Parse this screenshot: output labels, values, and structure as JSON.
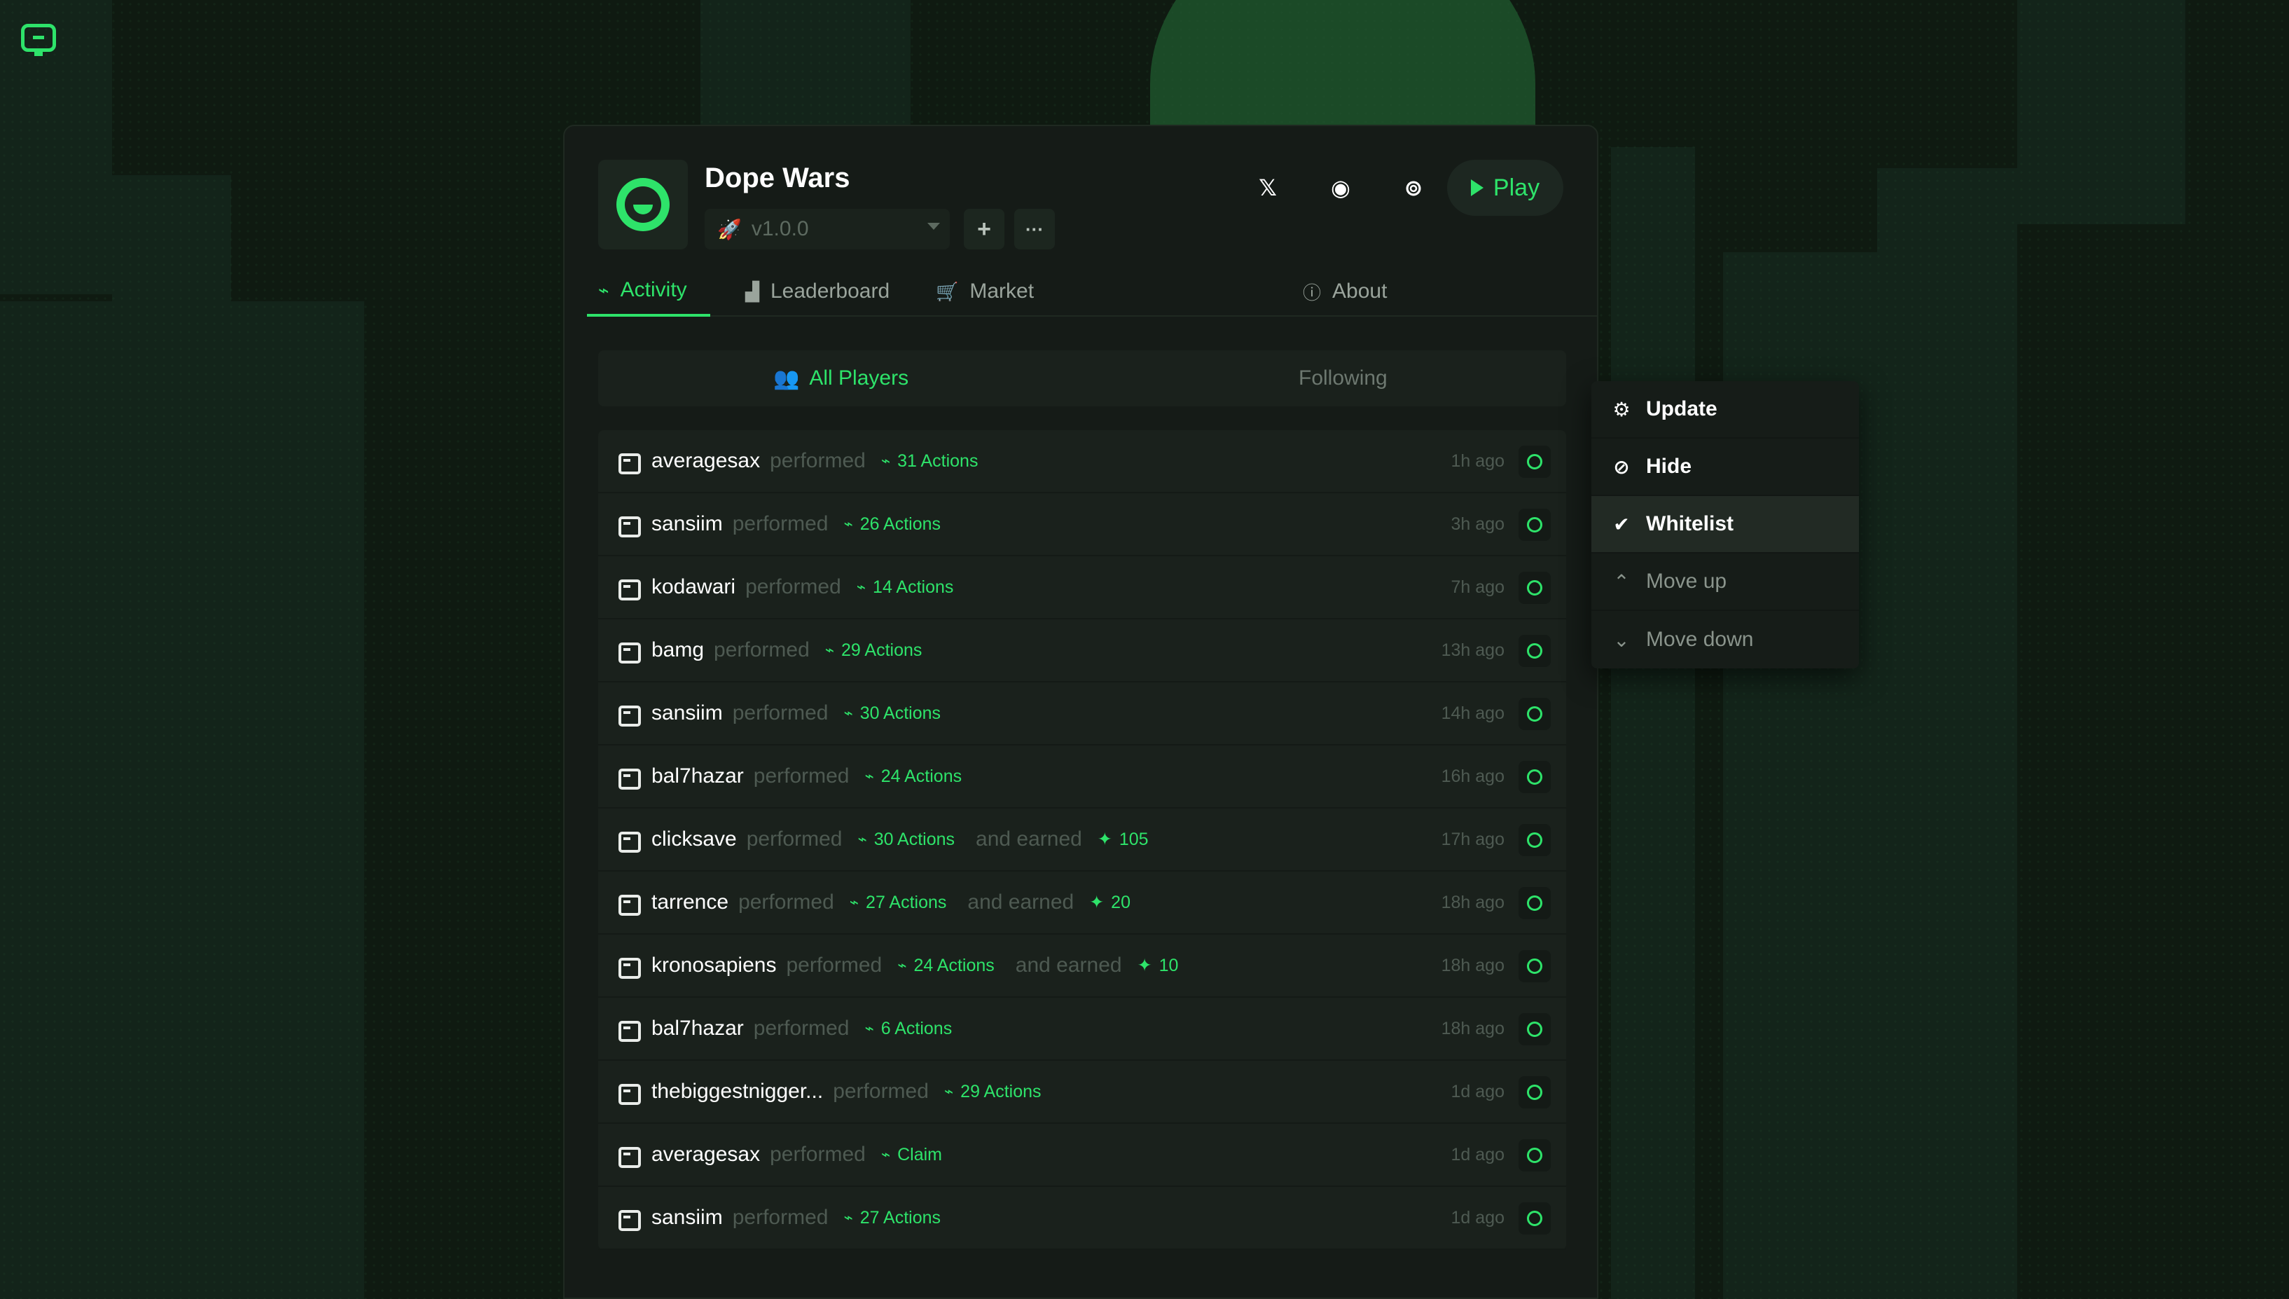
{
  "game": {
    "title": "Dope Wars",
    "version": "v1.0.0",
    "add_icon": "+",
    "more_icon": "···",
    "play_label": "Play"
  },
  "social": [
    {
      "name": "x-icon",
      "glyph": "𝕏"
    },
    {
      "name": "discord-icon",
      "glyph": "◉"
    },
    {
      "name": "github-icon",
      "glyph": "⊚"
    }
  ],
  "tabs": [
    {
      "label": "Activity",
      "icon": "activity-icon",
      "active": true
    },
    {
      "label": "Leaderboard",
      "icon": "leaderboard-icon"
    },
    {
      "label": "Market",
      "icon": "cart-icon"
    },
    {
      "label": "About",
      "icon": "info-icon"
    }
  ],
  "subtabs": {
    "all_players": "All Players",
    "following": "Following"
  },
  "menu": [
    {
      "label": "Update",
      "icon": "gear-icon",
      "state": "enabled"
    },
    {
      "label": "Hide",
      "icon": "eye-off-icon",
      "state": "enabled"
    },
    {
      "label": "Whitelist",
      "icon": "check-circle-icon",
      "state": "enabled",
      "highlight": true
    },
    {
      "label": "Move up",
      "icon": "chevron-up-icon",
      "state": "disabled"
    },
    {
      "label": "Move down",
      "icon": "chevron-down-icon",
      "state": "disabled"
    }
  ],
  "activity": [
    {
      "user": "averagesax",
      "verb": "performed",
      "actions": "31 Actions",
      "earned_label": "",
      "earned": "",
      "time": "1h ago"
    },
    {
      "user": "sansiim",
      "verb": "performed",
      "actions": "26 Actions",
      "earned_label": "",
      "earned": "",
      "time": "3h ago"
    },
    {
      "user": "kodawari",
      "verb": "performed",
      "actions": "14 Actions",
      "earned_label": "",
      "earned": "",
      "time": "7h ago"
    },
    {
      "user": "bamg",
      "verb": "performed",
      "actions": "29 Actions",
      "earned_label": "",
      "earned": "",
      "time": "13h ago"
    },
    {
      "user": "sansiim",
      "verb": "performed",
      "actions": "30 Actions",
      "earned_label": "",
      "earned": "",
      "time": "14h ago"
    },
    {
      "user": "bal7hazar",
      "verb": "performed",
      "actions": "24 Actions",
      "earned_label": "",
      "earned": "",
      "time": "16h ago"
    },
    {
      "user": "clicksave",
      "verb": "performed",
      "actions": "30 Actions",
      "earned_label": "and earned",
      "earned": "105",
      "time": "17h ago"
    },
    {
      "user": "tarrence",
      "verb": "performed",
      "actions": "27 Actions",
      "earned_label": "and earned",
      "earned": "20",
      "time": "18h ago"
    },
    {
      "user": "kronosapiens",
      "verb": "performed",
      "actions": "24 Actions",
      "earned_label": "and earned",
      "earned": "10",
      "time": "18h ago"
    },
    {
      "user": "bal7hazar",
      "verb": "performed",
      "actions": "6 Actions",
      "earned_label": "",
      "earned": "",
      "time": "18h ago"
    },
    {
      "user": "thebiggestnigger...",
      "verb": "performed",
      "actions": "29 Actions",
      "earned_label": "",
      "earned": "",
      "time": "1d ago"
    },
    {
      "user": "averagesax",
      "verb": "performed",
      "actions": "Claim",
      "earned_label": "",
      "earned": "",
      "time": "1d ago"
    },
    {
      "user": "sansiim",
      "verb": "performed",
      "actions": "27 Actions",
      "earned_label": "",
      "earned": "",
      "time": "1d ago"
    }
  ],
  "colors": {
    "accent": "#2ee36a",
    "background": "#0f1a11",
    "panel": "#151b17"
  }
}
